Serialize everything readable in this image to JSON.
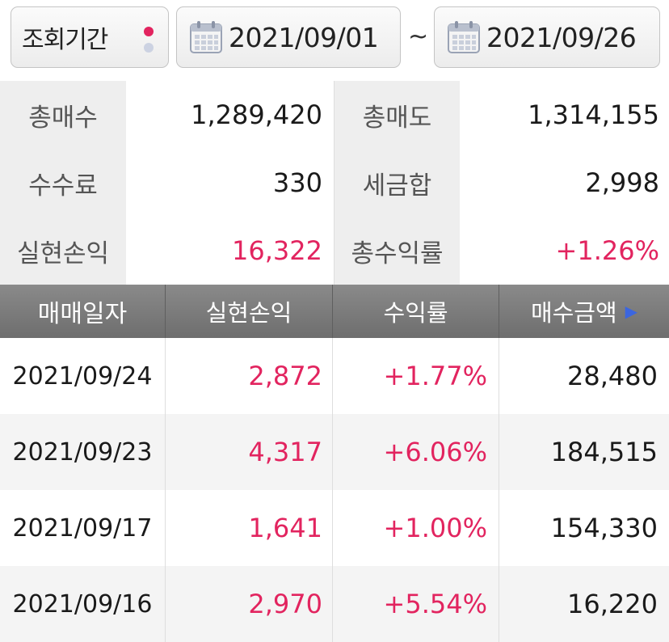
{
  "filter": {
    "period_label": "조회기간",
    "start_date": "2021/09/01",
    "separator": "~",
    "end_date": "2021/09/26"
  },
  "summary": {
    "total_buy_label": "총매수",
    "total_buy": "1,289,420",
    "total_sell_label": "총매도",
    "total_sell": "1,314,155",
    "fee_label": "수수료",
    "fee": "330",
    "tax_label": "세금합",
    "tax": "2,998",
    "realized_label": "실현손익",
    "realized": "16,322",
    "return_label": "총수익률",
    "return": "+1.26%"
  },
  "table": {
    "headers": [
      "매매일자",
      "실현손익",
      "수익률",
      "매수금액"
    ],
    "rows": [
      {
        "date": "2021/09/24",
        "pnl": "2,872",
        "rate": "+1.77%",
        "buy_amount": "28,480"
      },
      {
        "date": "2021/09/23",
        "pnl": "4,317",
        "rate": "+6.06%",
        "buy_amount": "184,515"
      },
      {
        "date": "2021/09/17",
        "pnl": "1,641",
        "rate": "+1.00%",
        "buy_amount": "154,330"
      },
      {
        "date": "2021/09/16",
        "pnl": "2,970",
        "rate": "+5.54%",
        "buy_amount": "16,220"
      }
    ]
  },
  "colors": {
    "profit": "#e2245f",
    "header_bg": "#7c7c7c",
    "label_bg": "#eeeeee",
    "accent_arrow": "#3b66e0"
  },
  "icons": [
    "calendar-icon",
    "page-dots-icon",
    "next-column-arrow-icon"
  ]
}
